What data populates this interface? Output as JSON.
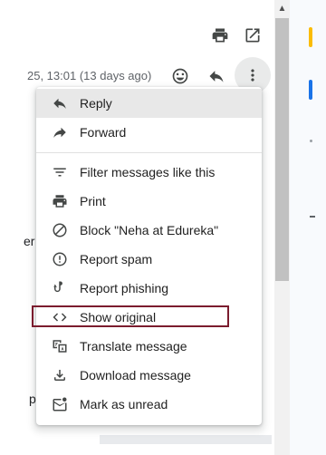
{
  "header": {
    "timestamp": "25, 13:01 (13 days ago)"
  },
  "background": {
    "fragment_1": "er",
    "fragment_2": "p"
  },
  "menu": {
    "items": [
      {
        "label": "Reply",
        "icon": "reply-icon"
      },
      {
        "label": "Forward",
        "icon": "forward-icon"
      },
      {
        "label": "Filter messages like this",
        "icon": "filter-icon"
      },
      {
        "label": "Print",
        "icon": "print-icon"
      },
      {
        "label": "Block \"Neha at Edureka\"",
        "icon": "block-icon"
      },
      {
        "label": "Report spam",
        "icon": "report-spam-icon"
      },
      {
        "label": "Report phishing",
        "icon": "phishing-hook-icon"
      },
      {
        "label": "Show original",
        "icon": "code-icon"
      },
      {
        "label": "Translate message",
        "icon": "translate-icon"
      },
      {
        "label": "Download message",
        "icon": "download-icon"
      },
      {
        "label": "Mark as unread",
        "icon": "mark-unread-icon"
      }
    ],
    "highlighted_item": "Show original"
  },
  "colors": {
    "highlight_border": "#7b1c2e",
    "side_accent_yellow": "#fbbc04",
    "side_accent_blue": "#1a73e8"
  }
}
